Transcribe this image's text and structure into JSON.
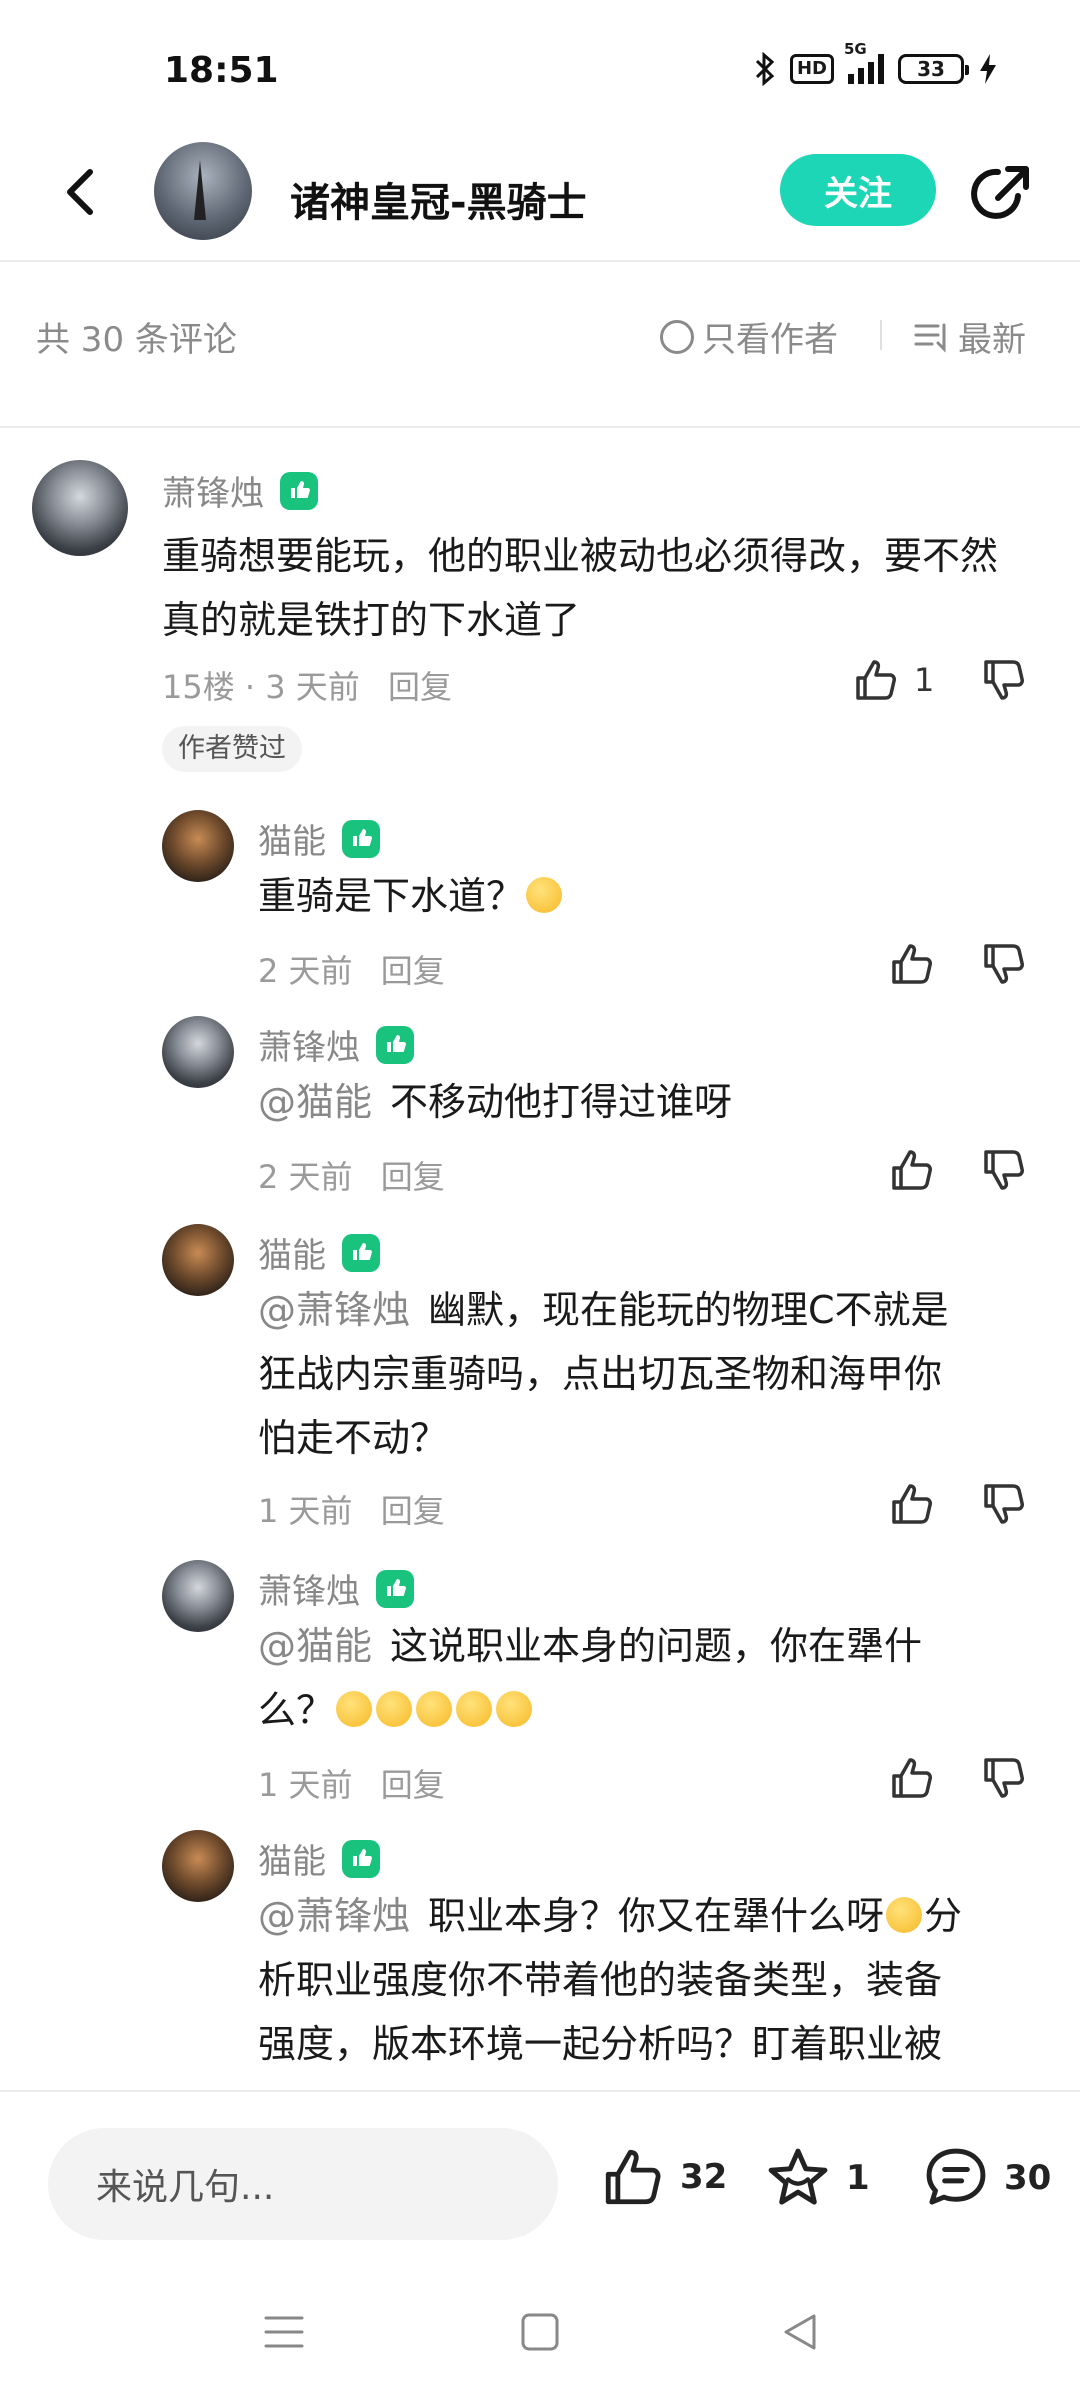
{
  "status": {
    "time": "18:51",
    "hd": "HD",
    "network": "5G",
    "battery": "33"
  },
  "header": {
    "title": "诸神皇冠-黑骑士",
    "follow_label": "关注"
  },
  "filter": {
    "count_text": "共 30 条评论",
    "author_only": "只看作者",
    "sort_label": "最新"
  },
  "comments": [
    {
      "user": "萧锋烛",
      "text": "重骑想要能玩，他的职业被动也必须得改，要不然真的就是铁打的下水道了",
      "meta": "15楼 · 3 天前",
      "reply": "回复",
      "likes": "1",
      "tag": "作者赞过"
    },
    {
      "user": "猫能",
      "text": "重骑是下水道？",
      "meta": "2 天前",
      "reply": "回复"
    },
    {
      "user": "萧锋烛",
      "mention": "@猫能",
      "text": "不移动他打得过谁呀",
      "meta": "2 天前",
      "reply": "回复"
    },
    {
      "user": "猫能",
      "mention": "@萧锋烛",
      "text_line1": "幽默，现在能玩的物理C不就是",
      "text_line2": "狂战内宗重骑吗，点出切瓦圣物和海甲你",
      "text_line3": "怕走不动？",
      "meta": "1 天前",
      "reply": "回复"
    },
    {
      "user": "萧锋烛",
      "mention": "@猫能",
      "text_line1": "这说职业本身的问题，你在犟什",
      "text_line2": "么？",
      "meta": "1 天前",
      "reply": "回复"
    },
    {
      "user": "猫能",
      "mention": "@萧锋烛",
      "text_line1": "职业本身？你又在犟什么呀",
      "text_line1b": "分",
      "text_line2": "析职业强度你不带着他的装备类型，装备",
      "text_line3": "强度，版本环境一起分析吗？盯着职业被"
    }
  ],
  "bottom": {
    "input_placeholder": "来说几句...",
    "likes": "32",
    "stars": "1",
    "comments": "30"
  },
  "colors": {
    "accent": "#1dd6b5",
    "badge": "#19c37d"
  }
}
